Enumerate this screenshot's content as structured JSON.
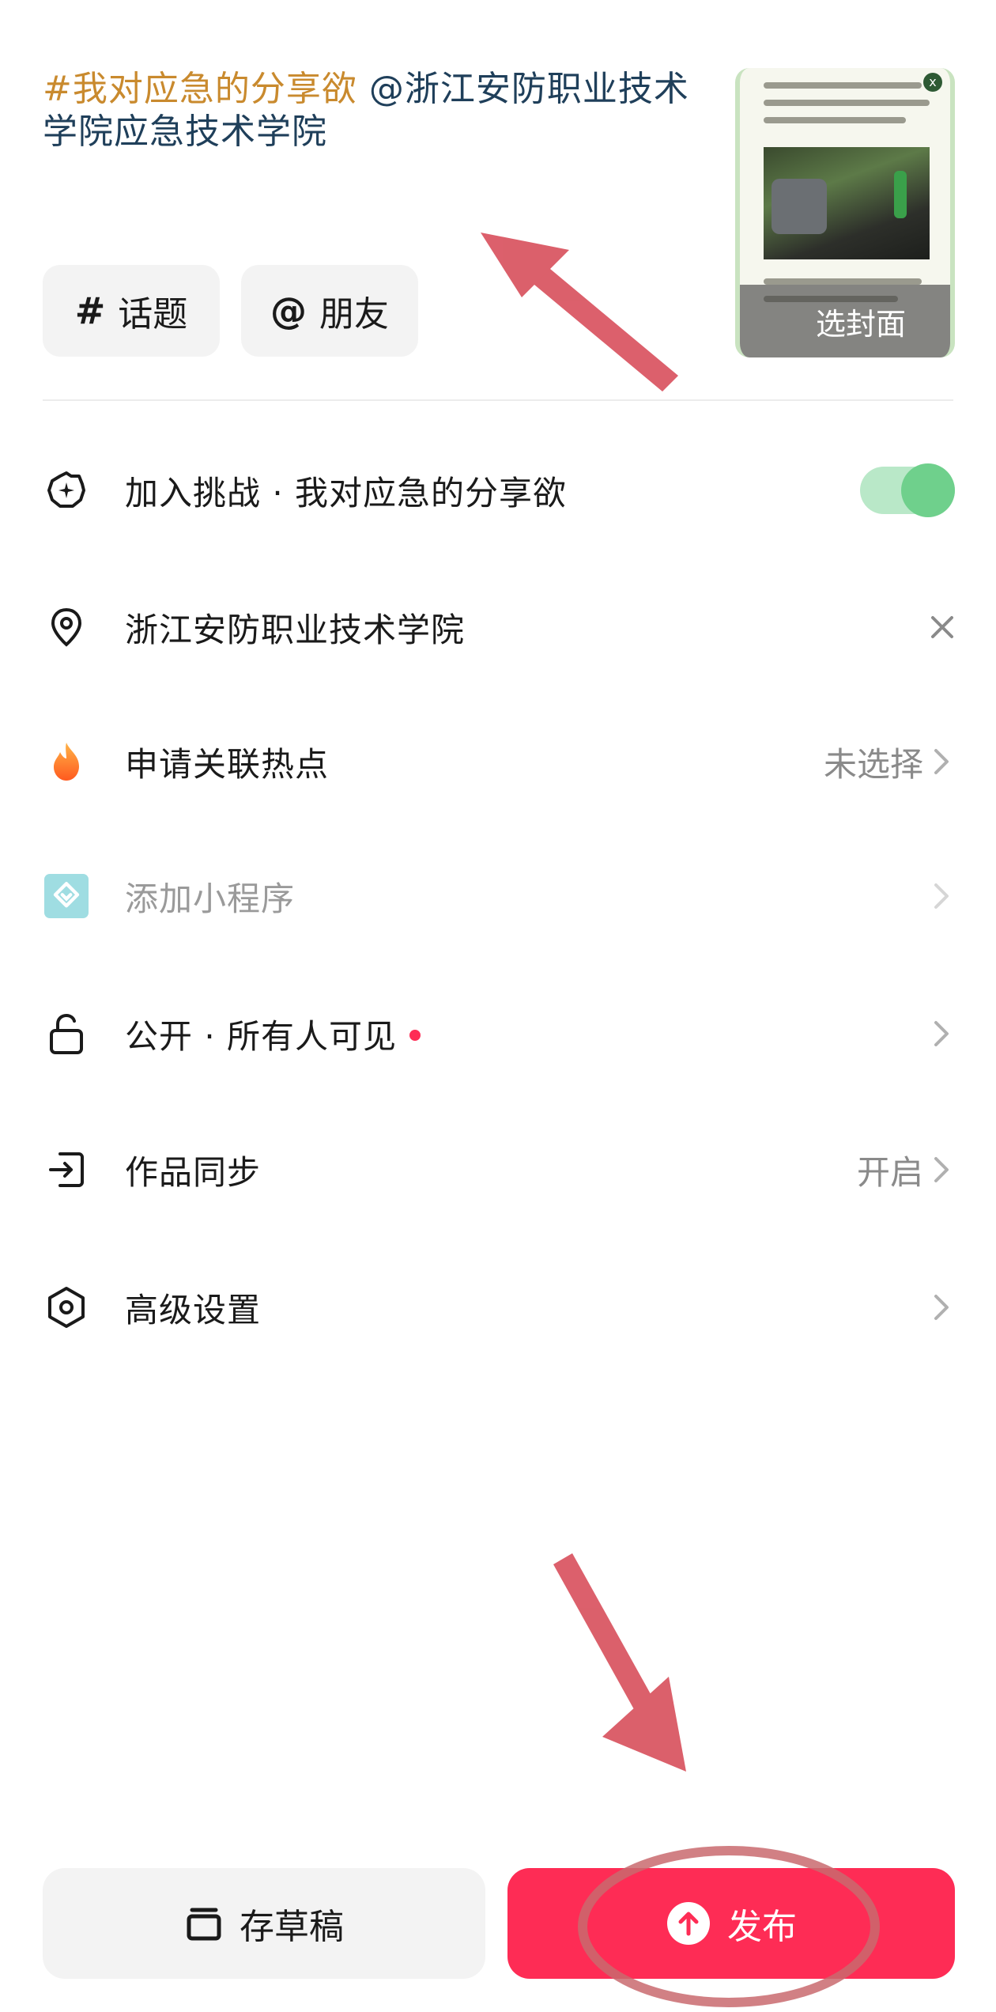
{
  "caption": {
    "hashtag": "#我对应急的分享欲",
    "mention": "@浙江安防职业技术学院应急技术学院"
  },
  "chips": {
    "topic_symbol": "#",
    "topic_label": "话题",
    "friend_symbol": "@",
    "friend_label": "朋友"
  },
  "cover": {
    "label": "选封面",
    "close": "x"
  },
  "rows": {
    "challenge": {
      "label": "加入挑战 · 我对应急的分享欲",
      "toggle_on": true
    },
    "location": {
      "label": "浙江安防职业技术学院"
    },
    "hotspot": {
      "label": "申请关联热点",
      "value": "未选择"
    },
    "miniapp": {
      "label": "添加小程序"
    },
    "privacy": {
      "label": "公开 · 所有人可见"
    },
    "sync": {
      "label": "作品同步",
      "value": "开启"
    },
    "advanced": {
      "label": "高级设置"
    }
  },
  "footer": {
    "draft_label": "存草稿",
    "publish_label": "发布"
  },
  "colors": {
    "accent": "#fe2c55",
    "toggle_on": "#6fd08c",
    "hashtag": "#c98a2e",
    "annotation": "#d9535f"
  }
}
